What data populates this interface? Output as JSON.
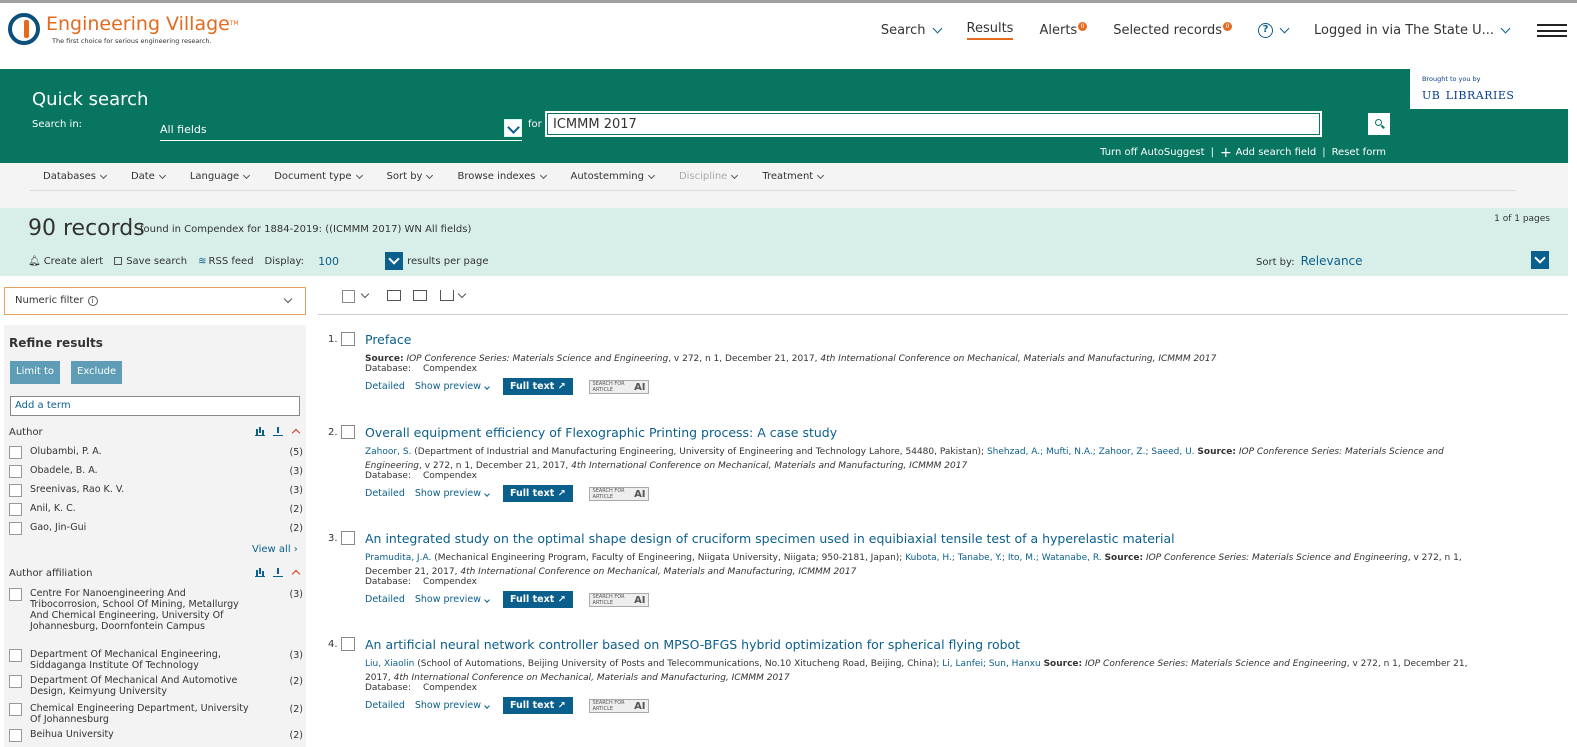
{
  "header": {
    "logo_title": "Engineering Village",
    "logo_tm": "TM",
    "logo_tagline": "The first choice for serious engineering research.",
    "nav": {
      "search": "Search",
      "results": "Results",
      "alerts": "Alerts",
      "alerts_count": "0",
      "selected_records": "Selected records",
      "selected_count": "0",
      "help": "?",
      "logged_in": "Logged in via The State U..."
    }
  },
  "quick_search": {
    "title": "Quick search",
    "search_in_label": "Search in:",
    "field": "All fields",
    "for_label": "for",
    "query": "ICMMM 2017",
    "links": {
      "autosuggest": "Turn off AutoSuggest",
      "add_field": "Add search field",
      "reset": "Reset form",
      "separator": "|"
    },
    "sponsor": {
      "brought": "Brought to you by",
      "ub": "UB",
      "libraries": "LIBRARIES"
    }
  },
  "filters": [
    {
      "label": "Databases",
      "disabled": false
    },
    {
      "label": "Date",
      "disabled": false
    },
    {
      "label": "Language",
      "disabled": false
    },
    {
      "label": "Document type",
      "disabled": false
    },
    {
      "label": "Sort by",
      "disabled": false
    },
    {
      "label": "Browse indexes",
      "disabled": false
    },
    {
      "label": "Autostemming",
      "disabled": false
    },
    {
      "label": "Discipline",
      "disabled": true
    },
    {
      "label": "Treatment",
      "disabled": false
    }
  ],
  "records": {
    "count_text": "90 records",
    "found_text": "found in Compendex for 1884-2019: ((ICMMM 2017) WN All fields)",
    "pages_text": "1 of 1 pages",
    "create_alert": "Create alert",
    "save_search": "Save search",
    "rss_feed": "RSS feed",
    "display_label": "Display:",
    "display_value": "100",
    "per_page": "results per page",
    "sort_label": "Sort by:",
    "sort_value": "Relevance"
  },
  "sidebar": {
    "numeric_filter": "Numeric filter",
    "info": "i",
    "refine_title": "Refine results",
    "limit_to": "Limit to",
    "exclude": "Exclude",
    "add_term": "Add a term",
    "author_head": "Author",
    "authors": [
      {
        "label": "Olubambi, P. A.",
        "count": "(5)"
      },
      {
        "label": "Obadele, B. A.",
        "count": "(3)"
      },
      {
        "label": "Sreenivas, Rao K. V.",
        "count": "(3)"
      },
      {
        "label": "Anil, K. C.",
        "count": "(2)"
      },
      {
        "label": "Gao, Jin-Gui",
        "count": "(2)"
      }
    ],
    "view_all": "View all",
    "affiliation_head": "Author affiliation",
    "affiliations": [
      {
        "label": "Centre For Nanoengineering And Tribocorrosion, School Of Mining, Metallurgy And Chemical Engineering, University Of Johannesburg, Doornfontein Campus",
        "count": "(3)"
      },
      {
        "label": "Department Of Mechanical Engineering, Siddaganga Institute Of Technology",
        "count": "(3)"
      },
      {
        "label": "Department Of Mechanical And Automotive Design, Keimyung University",
        "count": "(2)"
      },
      {
        "label": "Chemical Engineering Department, University Of Johannesburg",
        "count": "(2)"
      },
      {
        "label": "Beihua University",
        "count": "(2)"
      }
    ]
  },
  "results": {
    "database_label": "Database:",
    "database_value": "Compendex",
    "detailed": "Detailed",
    "show_preview": "Show preview",
    "full_text": "Full text",
    "sfa_line1": "SEARCH FOR",
    "sfa_line2": "ARTICLE",
    "sfa_ai": "AI",
    "items": [
      {
        "num": "1.",
        "title": "Preface",
        "pre": "",
        "source_label": "Source:",
        "source": "IOP Conference Series: Materials Science and Engineering",
        "detail": ", v 272, n 1, December 21, 2017,",
        "conf": "4th International Conference on Mechanical, Materials and Manufacturing, ICMMM 2017"
      },
      {
        "num": "2.",
        "title": "Overall equipment efficiency of Flexographic Printing process: A case study",
        "pre_author": "Zahoor, S.",
        "pre_aff": "(Department of Industrial and Manufacturing Engineering, University of Engineering and Technology Lahore, 54480, Pakistan);",
        "co_authors": "Shehzad, A.; Mufti, N.A.; Zahoor, Z.; Saeed, U.",
        "source_label": "Source:",
        "source": "IOP Conference Series: Materials Science and Engineering",
        "detail": ", v 272, n 1, December 21, 2017,",
        "conf": "4th International Conference on Mechanical, Materials and Manufacturing, ICMMM 2017"
      },
      {
        "num": "3.",
        "title": "An integrated study on the optimal shape design of cruciform specimen used in equibiaxial tensile test of a hyperelastic material",
        "pre_author": "Pramudita, J.A.",
        "pre_aff": "(Mechanical Engineering Program, Faculty of Engineering, Niigata University, Niigata; 950-2181, Japan);",
        "co_authors": "Kubota, H.; Tanabe, Y.; Ito, M.; Watanabe, R.",
        "source_label": "Source:",
        "source": "IOP Conference Series: Materials Science and Engineering",
        "detail": ", v 272, n 1, December 21, 2017,",
        "conf": "4th International Conference on Mechanical, Materials and Manufacturing, ICMMM 2017"
      },
      {
        "num": "4.",
        "title": "An artificial neural network controller based on MPSO-BFGS hybrid optimization for spherical flying robot",
        "pre_author": "Liu, Xiaolin",
        "pre_aff": "(School of Automations, Beijing University of Posts and Telecommunications, No.10 Xitucheng Road, Beijing, China);",
        "co_authors": "Li, Lanfei; Sun, Hanxu",
        "source_label": "Source:",
        "source": "IOP Conference Series: Materials Science and Engineering",
        "detail": ", v 272, n 1, December 21, 2017,",
        "conf": "4th International Conference on Mechanical, Materials and Manufacturing, ICMMM 2017"
      }
    ]
  }
}
